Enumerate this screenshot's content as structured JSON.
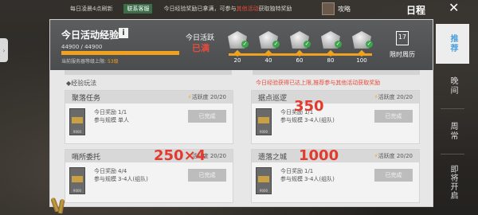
{
  "topbar": {
    "reset_text": "每日凌晨4点刷新",
    "support_tag": "联系客服",
    "hint_prefix": "今日经验奖励已拿满，可参与",
    "hint_red": "其他活动",
    "hint_suffix": "获取独特奖励",
    "guide_label": "攻略"
  },
  "header": {
    "schedule_title": "日程",
    "close_icon": "close-icon"
  },
  "right_tabs": [
    {
      "label": "推荐",
      "active": true
    },
    {
      "label": "晚间",
      "active": false
    },
    {
      "label": "周常",
      "active": false
    },
    {
      "label": "即将开启",
      "active": false
    }
  ],
  "exp": {
    "title": "今日活动经验",
    "info_icon": "info-icon",
    "value_text": "44900 / 44900",
    "progress_fraction": 1.0,
    "cap_prefix": "当前服务器等级上限:",
    "cap_level": "53级"
  },
  "activity": {
    "label": "今日活跃",
    "status": "已满",
    "milestones": [
      "20",
      "40",
      "60",
      "80",
      "100"
    ],
    "weekly_label": "限时周历",
    "calendar_day": "17"
  },
  "section": {
    "header": "◆经验玩法",
    "note": "今日经验获得已达上限,推荐参与其他活动获取奖励"
  },
  "cards": [
    {
      "title": "聚落任务",
      "points_label": "活跃度",
      "points": "20/20",
      "reward_key": "今日奖励",
      "reward_val": "1/1",
      "mode_key": "参与规模",
      "mode_val": "单人",
      "button": "已完成",
      "code": "9000"
    },
    {
      "title": "据点巡逻",
      "points_label": "活跃度",
      "points": "20/20",
      "reward_key": "今日奖励",
      "reward_val": "1/1",
      "mode_key": "参与规模",
      "mode_val": "3-4人(组队)",
      "button": "已完成",
      "code": "9000"
    },
    {
      "title": "哨所委托",
      "points_label": "活跃度",
      "points": "20/20",
      "reward_key": "今日奖励",
      "reward_val": "4/4",
      "mode_key": "参与规模",
      "mode_val": "3-4人(组队)",
      "button": "已完成",
      "code": "9000"
    },
    {
      "title": "遗落之城",
      "points_label": "活跃度",
      "points": "20/20",
      "reward_key": "今日奖励",
      "reward_val": "1/1",
      "mode_key": "参与规模",
      "mode_val": "3-4人(组队)",
      "button": "已完成",
      "code": "9000"
    }
  ],
  "annotations": {
    "patrol": "350",
    "outpost": "250×4",
    "lost_city": "1000"
  },
  "colors": {
    "accent_orange": "#f0a21e",
    "alert_red": "#e84b3c",
    "tab_active_blue": "#4a9fe0"
  }
}
